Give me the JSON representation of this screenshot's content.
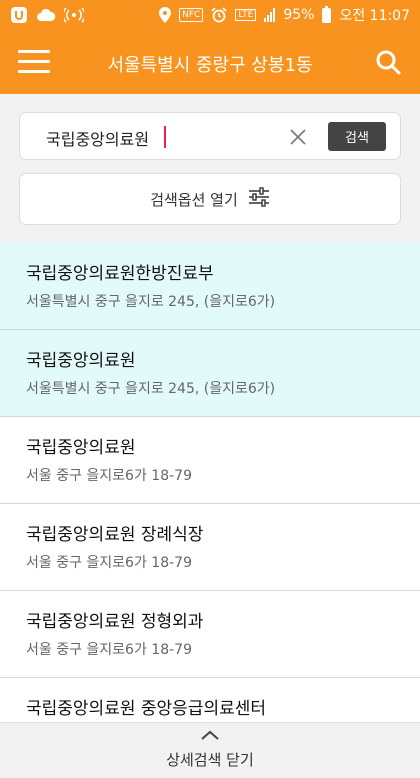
{
  "status_bar": {
    "battery": "95%",
    "time": "오전 11:07",
    "icons": [
      "app-u-icon",
      "cloud-icon",
      "wifi-icon",
      "location-icon",
      "nfc-icon",
      "alarm-icon",
      "lte-icon",
      "signal-icon",
      "battery-icon"
    ],
    "nfc_label": "NFC",
    "lte_label": "LTE"
  },
  "app_bar": {
    "title": "서울특별시 중랑구 상봉1동",
    "menu_icon": "hamburger-icon",
    "search_icon": "search-icon"
  },
  "search": {
    "value": "국립중앙의료원",
    "button_label": "검색",
    "clear_icon": "close-icon"
  },
  "options": {
    "label": "검색옵션 열기",
    "icon": "filter-sliders-icon"
  },
  "results": [
    {
      "name": "국립중앙의료원한방진료부",
      "address": "서울특별시 중구 을지로 245, (을지로6가)",
      "highlighted": true
    },
    {
      "name": "국립중앙의료원",
      "address": "서울특별시 중구 을지로 245, (을지로6가)",
      "highlighted": true
    },
    {
      "name": "국립중앙의료원",
      "address": "서울 중구 을지로6가 18-79",
      "highlighted": false
    },
    {
      "name": "국립중앙의료원 장례식장",
      "address": "서울 중구 을지로6가 18-79",
      "highlighted": false
    },
    {
      "name": "국립중앙의료원 정형외과",
      "address": "서울 중구 을지로6가 18-79",
      "highlighted": false
    },
    {
      "name": "국립중앙의료원 중앙응급의료센터",
      "address": "",
      "highlighted": false
    }
  ],
  "bottom": {
    "label": "상세검색 닫기",
    "icon": "chevron-up-icon"
  },
  "colors": {
    "primary": "#f7931e",
    "highlight": "#e2fbfa",
    "search_button": "#444444"
  }
}
